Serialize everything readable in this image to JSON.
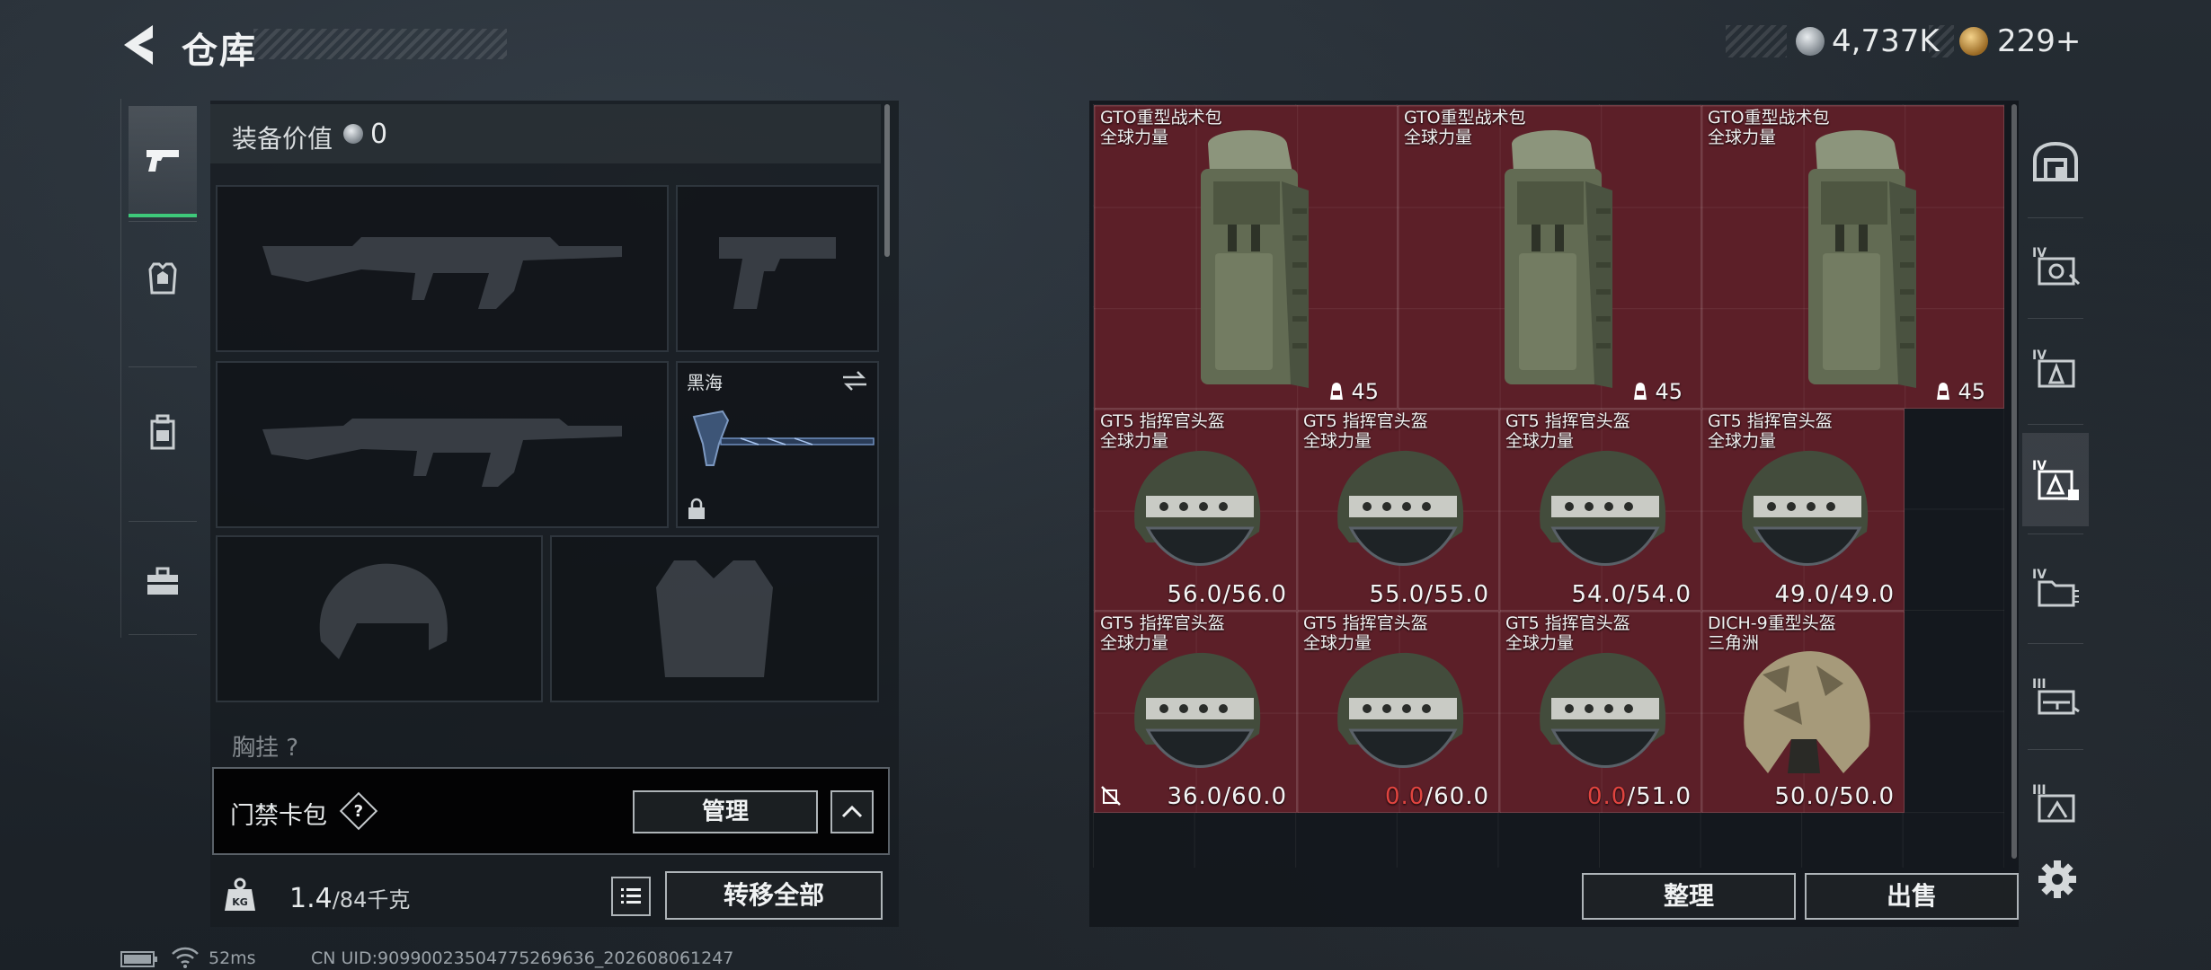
{
  "header": {
    "title": "仓库",
    "currency_silver": "4,737K",
    "currency_gold": "229+"
  },
  "left_tabs": [
    {
      "icon": "pistol-icon",
      "active": true
    },
    {
      "icon": "armor-icon",
      "active": false
    },
    {
      "icon": "backpack-icon",
      "active": false
    },
    {
      "icon": "toolbox-icon",
      "active": false
    }
  ],
  "loadout": {
    "value_label": "装备价值",
    "value_amount": "0",
    "melee_name": "黑海",
    "rig_label": "胸挂 ?",
    "access_card_label": "门禁卡包",
    "help_mark": "?",
    "manage_label": "管理",
    "weight_current": "1.4",
    "weight_capacity": "/84千克",
    "transfer_all_label": "转移全部"
  },
  "stash": {
    "items": [
      {
        "name": "GTO重型战术包",
        "faction": "全球力量",
        "kind": "backpack",
        "capacity": "45"
      },
      {
        "name": "GTO重型战术包",
        "faction": "全球力量",
        "kind": "backpack",
        "capacity": "45"
      },
      {
        "name": "GTO重型战术包",
        "faction": "全球力量",
        "kind": "backpack",
        "capacity": "45"
      },
      {
        "name": "GT5 指挥官头盔",
        "faction": "全球力量",
        "kind": "helmet",
        "dur_current": "56.0",
        "dur_max": "/56.0",
        "broken": false
      },
      {
        "name": "GT5 指挥官头盔",
        "faction": "全球力量",
        "kind": "helmet",
        "dur_current": "55.0",
        "dur_max": "/55.0",
        "broken": false
      },
      {
        "name": "GT5 指挥官头盔",
        "faction": "全球力量",
        "kind": "helmet",
        "dur_current": "54.0",
        "dur_max": "/54.0",
        "broken": false
      },
      {
        "name": "GT5 指挥官头盔",
        "faction": "全球力量",
        "kind": "helmet",
        "dur_current": "49.0",
        "dur_max": "/49.0",
        "broken": false
      },
      {
        "name": "GT5 指挥官头盔",
        "faction": "全球力量",
        "kind": "helmet",
        "dur_current": "36.0",
        "dur_max": "/60.0",
        "broken": false,
        "flag_icon": true
      },
      {
        "name": "GT5 指挥官头盔",
        "faction": "全球力量",
        "kind": "helmet",
        "dur_current": "0.0",
        "dur_max": "/60.0",
        "broken": true
      },
      {
        "name": "GT5 指挥官头盔",
        "faction": "全球力量",
        "kind": "helmet",
        "dur_current": "0.0",
        "dur_max": "/51.0",
        "broken": true
      },
      {
        "name": "DICH-9重型头盔",
        "faction": "三角洲",
        "kind": "helmet-beige",
        "dur_current": "50.0",
        "dur_max": "/50.0",
        "broken": false
      }
    ],
    "sort_label": "整理",
    "sell_label": "出售"
  },
  "right_tabs": [
    {
      "icon": "home-base-icon",
      "label": ""
    },
    {
      "icon": "tier-iv-container-icon",
      "label": "IV"
    },
    {
      "icon": "tier-iv-armor-icon",
      "label": "IV"
    },
    {
      "icon": "tier-iv-armor-locked-icon",
      "label": "IV"
    },
    {
      "icon": "tier-iv-folder-icon",
      "label": "IV"
    },
    {
      "icon": "tier-iii-weapon-icon",
      "label": "III"
    },
    {
      "icon": "tier-iii-box-icon",
      "label": "III"
    }
  ],
  "status_bar": {
    "ping": "52ms",
    "uid": "CN UID:9099002350477526963​6_202608061247"
  },
  "colors": {
    "item_bg": "#5c1f28",
    "accent_green": "#3ec97a",
    "durability_zero": "#e0443f"
  }
}
